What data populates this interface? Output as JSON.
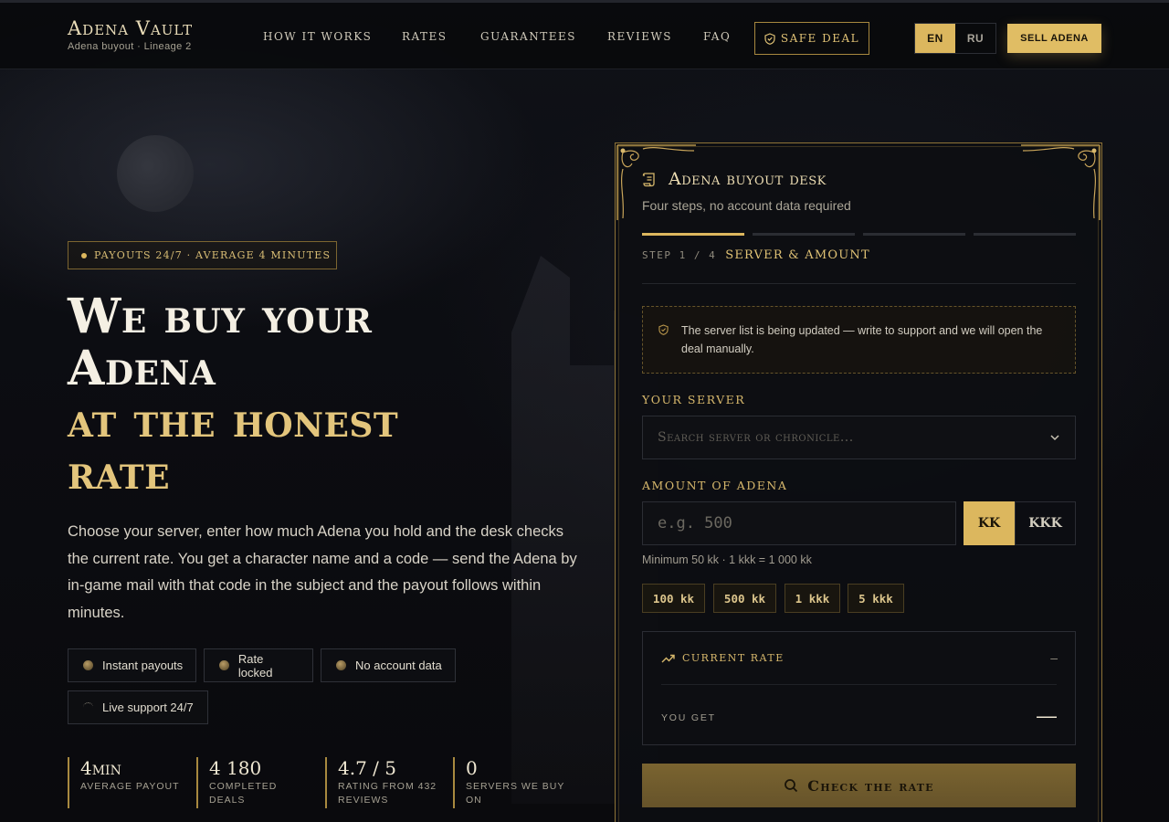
{
  "brand": {
    "name": "Adena Vault",
    "subtitle": "Adena buyout · Lineage 2"
  },
  "nav": {
    "items": [
      {
        "label": "HOW IT WORKS"
      },
      {
        "label": "RATES"
      },
      {
        "label": "GUARANTEES"
      },
      {
        "label": "REVIEWS"
      },
      {
        "label": "FAQ"
      }
    ],
    "safe_deal": "SAFE DEAL",
    "lang": {
      "active": "EN",
      "other": "RU"
    },
    "sell_button": "SELL ADENA"
  },
  "hero": {
    "pill": "PAYOUTS 24/7 · AVERAGE 4 MINUTES",
    "title_line1": "We buy your",
    "title_line2": "Adena",
    "title_line3": "at the honest",
    "title_line4": "rate",
    "description": "Choose your server, enter how much Adena you hold and the desk checks the current rate. You get a character name and a code — send the Adena by in-game mail with that code in the subject and the payout follows within minutes.",
    "features": [
      "Instant payouts",
      "Rate locked",
      "No account data",
      "Live support 24/7"
    ],
    "stats": [
      {
        "value": "4min",
        "label1": "AVERAGE PAYOUT",
        "label2": ""
      },
      {
        "value": "4 180",
        "label1": "COMPLETED",
        "label2": "DEALS"
      },
      {
        "value": "4.7 / 5",
        "label1": "RATING FROM 432",
        "label2": "REVIEWS"
      },
      {
        "value": "0",
        "label1": "SERVERS WE BUY",
        "label2": "ON"
      }
    ]
  },
  "desk": {
    "title": "Adena buyout desk",
    "subtitle": "Four steps, no account data required",
    "step_counter": "STEP 1 / 4",
    "step_name": "SERVER & AMOUNT",
    "steps_total": 4,
    "steps_active": 1,
    "notice": "The server list is being updated — write to support and we will open the deal manually.",
    "server_label": "YOUR SERVER",
    "server_placeholder": "Search server or chronicle...",
    "amount_label": "AMOUNT OF ADENA",
    "amount_placeholder": "e.g. 500",
    "units": {
      "active": "KK",
      "other": "KKK"
    },
    "minimum": "Minimum 50 kk · 1 kkk = 1 000 kk",
    "chips": [
      "100 kk",
      "500 kk",
      "1 kkk",
      "5 kkk"
    ],
    "rate_label": "CURRENT RATE",
    "rate_value": "–",
    "you_get_label": "YOU GET",
    "you_get_value": "—",
    "check_button": "Check the rate"
  },
  "colors": {
    "accent": "#dcb75e",
    "background": "#0b0c10",
    "text": "#e8e2d2"
  }
}
